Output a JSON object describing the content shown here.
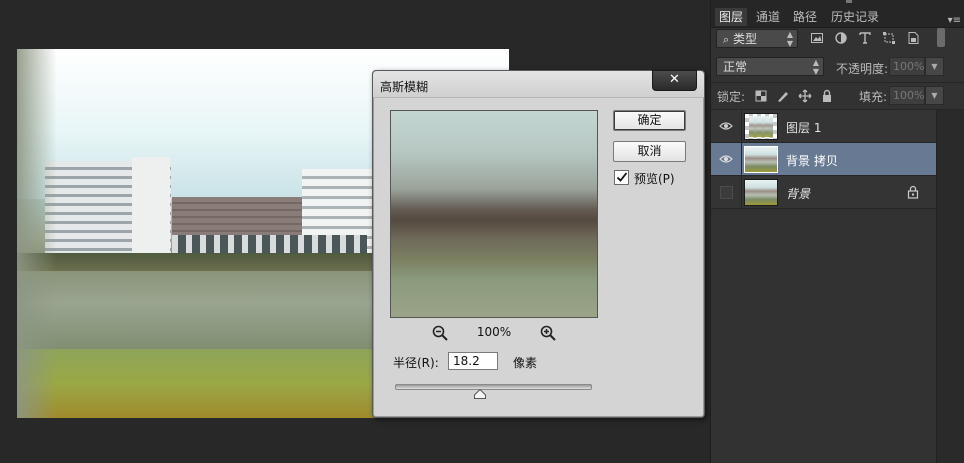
{
  "dialog": {
    "title": "高斯模糊",
    "close_label": "✕",
    "ok_label": "确定",
    "cancel_label": "取消",
    "preview_label": "预览(P)",
    "preview_checked": true,
    "zoom_level": "100%",
    "radius_label": "半径(R):",
    "radius_value": "18.2",
    "radius_unit": "像素",
    "radius_slider_fraction": 0.43
  },
  "panel": {
    "tabs": [
      {
        "label": "图层",
        "active": true
      },
      {
        "label": "通道",
        "active": false
      },
      {
        "label": "路径",
        "active": false
      },
      {
        "label": "历史记录",
        "active": false
      }
    ],
    "menu_icon": "panel-menu-icon",
    "kind_filter": "类型",
    "blend_mode": "正常",
    "opacity_label": "不透明度:",
    "opacity_value": "100%",
    "lock_label": "锁定:",
    "fill_label": "填充:",
    "fill_value": "100%",
    "layers": [
      {
        "name": "图层 1",
        "visible": true,
        "selected": false,
        "italic": false,
        "locked": false
      },
      {
        "name": "背景 拷贝",
        "visible": true,
        "selected": true,
        "italic": false,
        "locked": false
      },
      {
        "name": "背景",
        "visible": false,
        "selected": false,
        "italic": true,
        "locked": true
      }
    ]
  },
  "colors": {
    "selected_layer": "#687a93",
    "panel_bg": "#323232",
    "dialog_bg": "#d4d4d4"
  }
}
